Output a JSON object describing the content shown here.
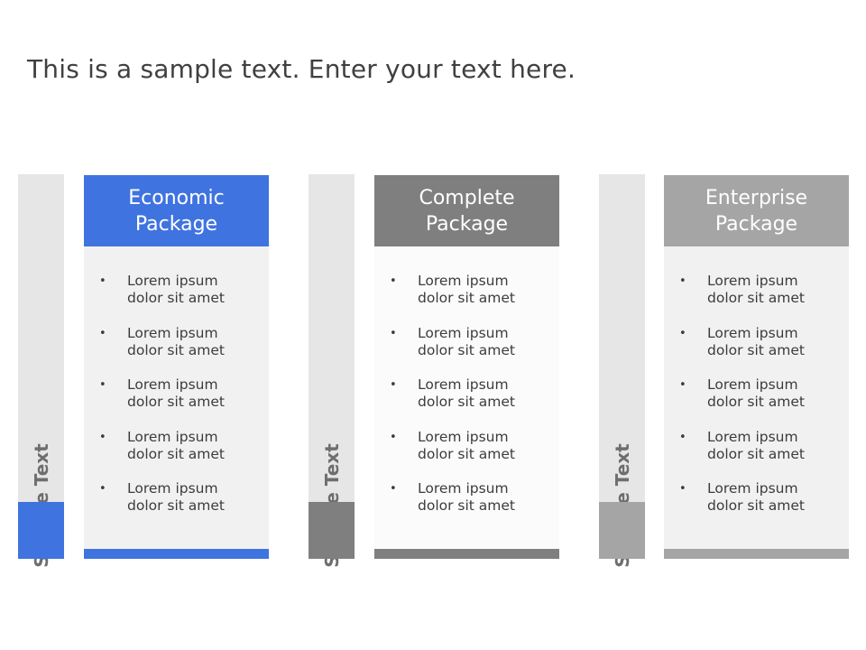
{
  "title": "This is a sample text. Enter your text here.",
  "columns": [
    {
      "side_label": "Sample Text",
      "header": [
        "Economic",
        "Package"
      ],
      "accent_color": "#3f73e0",
      "header_color": "#3f73e0",
      "body_bg": "#f1f1f1",
      "items": [
        [
          "Lorem ipsum",
          "dolor sit amet"
        ],
        [
          "Lorem ipsum",
          "dolor sit amet"
        ],
        [
          "Lorem ipsum",
          "dolor sit amet"
        ],
        [
          "Lorem ipsum",
          "dolor sit amet"
        ],
        [
          "Lorem ipsum",
          "dolor sit amet"
        ]
      ]
    },
    {
      "side_label": "Sample Text",
      "header": [
        "Complete",
        "Package"
      ],
      "accent_color": "#7f7f7f",
      "header_color": "#7f7f7f",
      "body_bg": "#fbfbfb",
      "items": [
        [
          "Lorem ipsum",
          "dolor sit amet"
        ],
        [
          "Lorem ipsum",
          "dolor sit amet"
        ],
        [
          "Lorem ipsum",
          "dolor sit amet"
        ],
        [
          "Lorem ipsum",
          "dolor sit amet"
        ],
        [
          "Lorem ipsum",
          "dolor sit amet"
        ]
      ]
    },
    {
      "side_label": "Sample Text",
      "header": [
        "Enterprise",
        "Package"
      ],
      "accent_color": "#a5a5a5",
      "header_color": "#a5a5a5",
      "body_bg": "#f1f1f1",
      "items": [
        [
          "Lorem ipsum",
          "dolor sit amet"
        ],
        [
          "Lorem ipsum",
          "dolor sit amet"
        ],
        [
          "Lorem ipsum",
          "dolor sit amet"
        ],
        [
          "Lorem ipsum",
          "dolor sit amet"
        ],
        [
          "Lorem ipsum",
          "dolor sit amet"
        ]
      ]
    }
  ]
}
